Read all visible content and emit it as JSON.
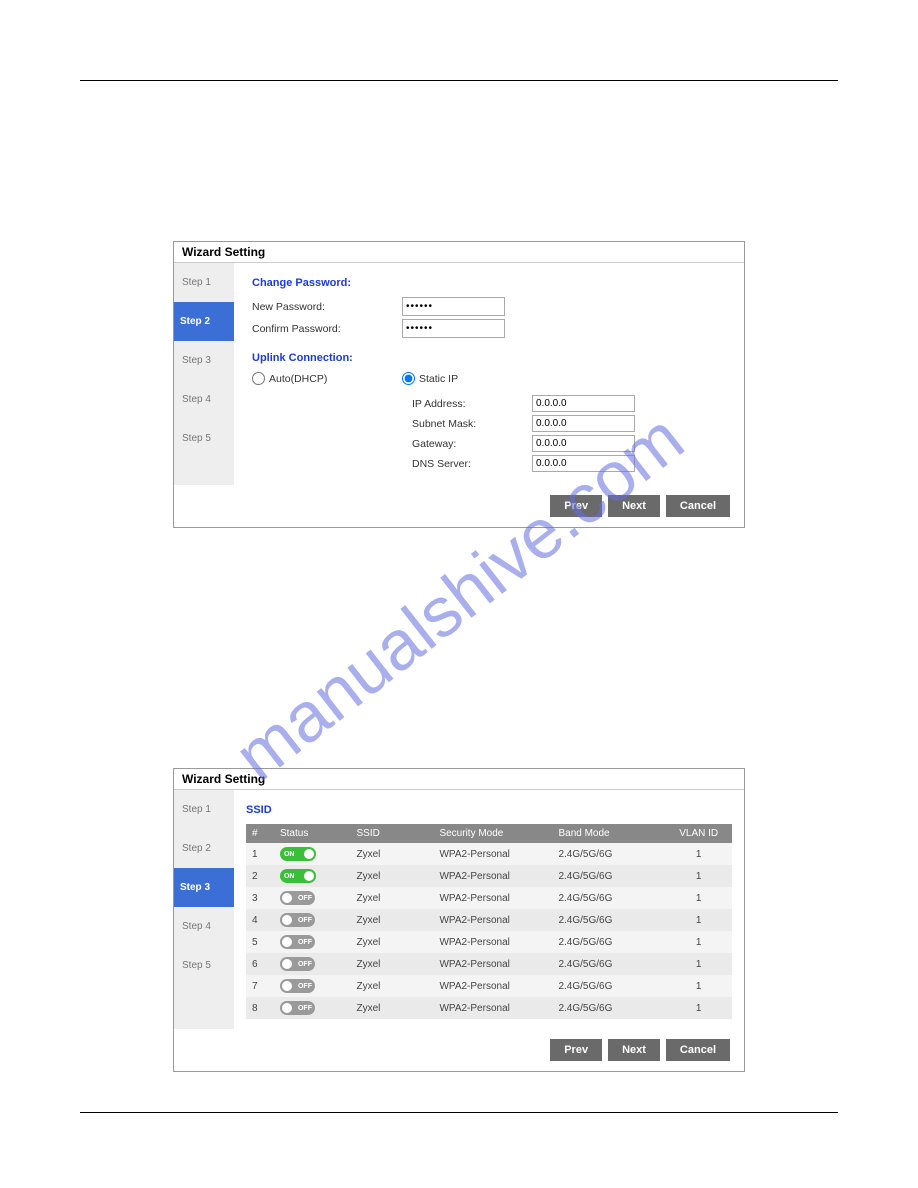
{
  "watermark_text": "manualshive.com",
  "panel1": {
    "title": "Wizard Setting",
    "steps": [
      "Step 1",
      "Step 2",
      "Step 3",
      "Step 4",
      "Step 5"
    ],
    "active_step_index": 1,
    "change_password_heading": "Change Password:",
    "new_password_label": "New Password:",
    "confirm_password_label": "Confirm Password:",
    "new_password_value": "••••••",
    "confirm_password_value": "••••••",
    "uplink_heading": "Uplink Connection:",
    "radio_auto_label": "Auto(DHCP)",
    "radio_static_label": "Static IP",
    "static_selected": true,
    "ip_label": "IP Address:",
    "ip_value": "0.0.0.0",
    "subnet_label": "Subnet Mask:",
    "subnet_value": "0.0.0.0",
    "gateway_label": "Gateway:",
    "gateway_value": "0.0.0.0",
    "dns_label": "DNS Server:",
    "dns_value": "0.0.0.0",
    "buttons": {
      "prev": "Prev",
      "next": "Next",
      "cancel": "Cancel"
    }
  },
  "panel2": {
    "title": "Wizard Setting",
    "steps": [
      "Step 1",
      "Step 2",
      "Step 3",
      "Step 4",
      "Step 5"
    ],
    "active_step_index": 2,
    "ssid_heading": "SSID",
    "columns": [
      "#",
      "Status",
      "SSID",
      "Security Mode",
      "Band Mode",
      "VLAN ID"
    ],
    "toggle_on_label": "ON",
    "toggle_off_label": "OFF",
    "rows": [
      {
        "num": "1",
        "status": "on",
        "ssid": "Zyxel",
        "sec": "WPA2-Personal",
        "band": "2.4G/5G/6G",
        "vlan": "1"
      },
      {
        "num": "2",
        "status": "on",
        "ssid": "Zyxel",
        "sec": "WPA2-Personal",
        "band": "2.4G/5G/6G",
        "vlan": "1"
      },
      {
        "num": "3",
        "status": "off",
        "ssid": "Zyxel",
        "sec": "WPA2-Personal",
        "band": "2.4G/5G/6G",
        "vlan": "1"
      },
      {
        "num": "4",
        "status": "off",
        "ssid": "Zyxel",
        "sec": "WPA2-Personal",
        "band": "2.4G/5G/6G",
        "vlan": "1"
      },
      {
        "num": "5",
        "status": "off",
        "ssid": "Zyxel",
        "sec": "WPA2-Personal",
        "band": "2.4G/5G/6G",
        "vlan": "1"
      },
      {
        "num": "6",
        "status": "off",
        "ssid": "Zyxel",
        "sec": "WPA2-Personal",
        "band": "2.4G/5G/6G",
        "vlan": "1"
      },
      {
        "num": "7",
        "status": "off",
        "ssid": "Zyxel",
        "sec": "WPA2-Personal",
        "band": "2.4G/5G/6G",
        "vlan": "1"
      },
      {
        "num": "8",
        "status": "off",
        "ssid": "Zyxel",
        "sec": "WPA2-Personal",
        "band": "2.4G/5G/6G",
        "vlan": "1"
      }
    ],
    "buttons": {
      "prev": "Prev",
      "next": "Next",
      "cancel": "Cancel"
    }
  }
}
